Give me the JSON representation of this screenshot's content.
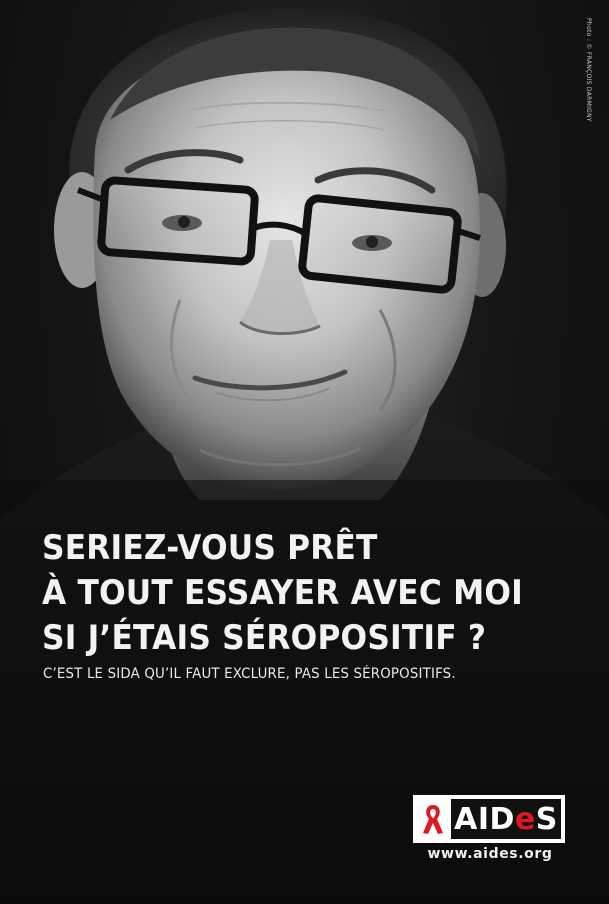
{
  "credit": "Photo : © FRANÇOIS DARMIGNY",
  "headline": {
    "lines": [
      "SERIEZ-VOUS PRÊT",
      "À TOUT ESSAYER AVEC MOI",
      "SI J’ÉTAIS SÉROPOSITIF ?"
    ]
  },
  "tagline": "C’EST LE SIDA QU’IL FAUT EXCLURE, PAS LES SÉROPOSITIFS.",
  "logo": {
    "word_before": "AID",
    "word_accent": "e",
    "word_after": "S",
    "icon": "red-ribbon-icon",
    "accent_color": "#e0171f"
  },
  "website": "www.aides.org",
  "photo": {
    "subject": "smiling man with dark rectangular glasses, black and white portrait"
  }
}
